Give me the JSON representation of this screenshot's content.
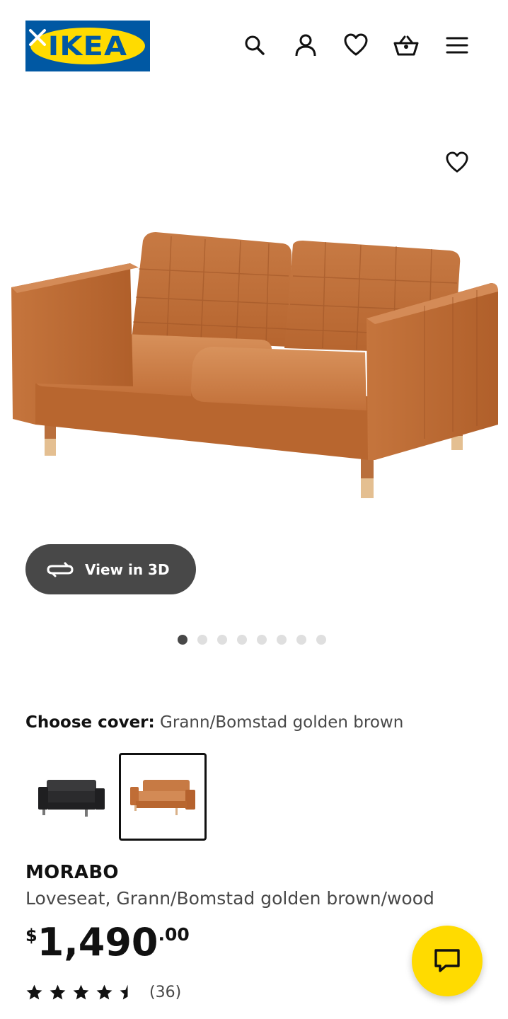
{
  "header": {
    "logo_text": "IKEA",
    "icons": [
      "close-icon",
      "search-icon",
      "user-icon",
      "heart-icon",
      "cart-icon",
      "menu-icon"
    ]
  },
  "gallery": {
    "favorite_icon": "heart-icon",
    "view_3d_label": "View in 3D",
    "image_count": 8,
    "active_image": 1
  },
  "cover": {
    "label": "Choose cover:",
    "value": "Grann/Bomstad golden brown",
    "options": [
      {
        "color": "#2b2b2d",
        "selected": false
      },
      {
        "color": "#c8743e",
        "selected": true
      }
    ]
  },
  "product": {
    "name": "MORABO",
    "description": "Loveseat, Grann/Bomstad golden brown/wood",
    "price_currency": "$",
    "price_integer": "1,490",
    "price_decimal": ".00",
    "rating": 4.5,
    "review_count": "(36)"
  },
  "colors": {
    "ikea_blue": "#0058a3",
    "ikea_yellow": "#ffdb00",
    "leather": "#c8743e",
    "pill": "#484848"
  }
}
